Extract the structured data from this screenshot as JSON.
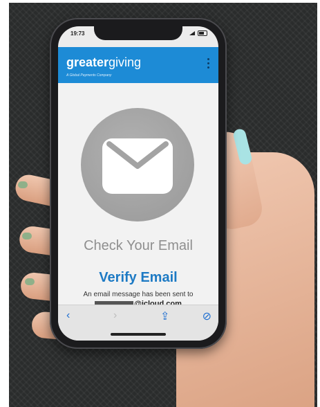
{
  "status_bar": {
    "time": "19:73"
  },
  "header": {
    "brand_bold": "greater",
    "brand_light": "giving",
    "tagline": "A Global Payments Company"
  },
  "content": {
    "check_email": "Check Your Email",
    "verify_email": "Verify Email",
    "message": "An email message has been sent to",
    "email_suffix": "@icloud.com"
  },
  "browser_toolbar": {
    "back": "‹",
    "forward": "›",
    "share": "⇪",
    "compass": "⊘"
  },
  "colors": {
    "brand_blue": "#1d8bd6",
    "verify_blue": "#1d7ac4",
    "nav_blue": "#1f6fd1"
  },
  "icons": [
    "envelope-icon",
    "kebab-menu-icon",
    "back-icon",
    "forward-icon",
    "share-icon",
    "compass-icon"
  ]
}
